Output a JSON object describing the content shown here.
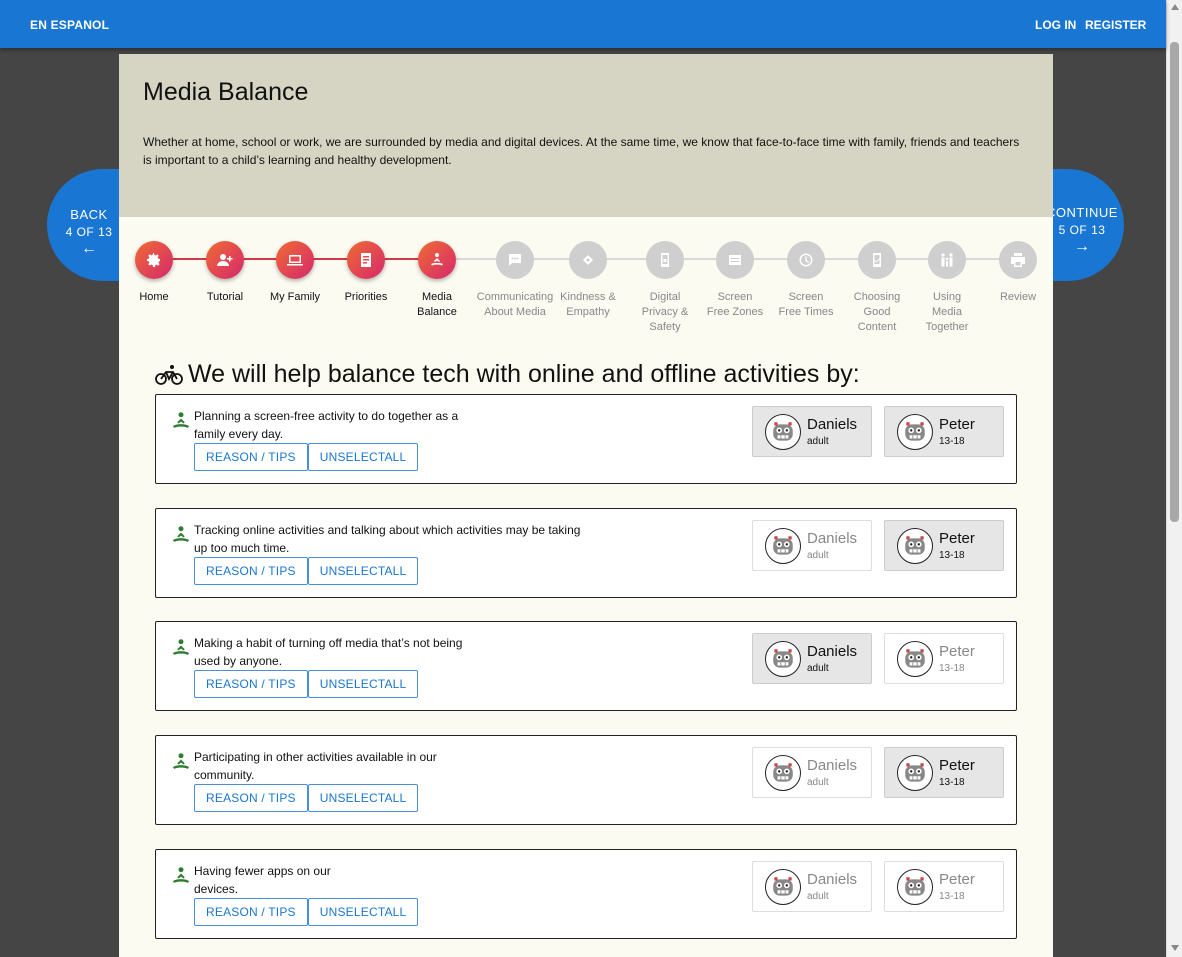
{
  "topbar": {
    "language_link": "EN ESPANOL",
    "login": "LOG IN",
    "register": "REGISTER"
  },
  "nav": {
    "back": {
      "label": "BACK",
      "position": "4 OF 13",
      "arrow": "←"
    },
    "continue": {
      "label": "CONTINUE",
      "position": "5 OF 13",
      "arrow": "→"
    }
  },
  "header": {
    "title": "Media Balance",
    "description": "Whether at home, school or work, we are surrounded by media and digital devices. At the same time, we know that face-to-face time with family, friends and teachers is important to a child’s learning and healthy development."
  },
  "steps": [
    {
      "label": "Home",
      "state": "active",
      "icon": "gear-icon"
    },
    {
      "label": "Tutorial",
      "state": "active",
      "icon": "person-add-icon"
    },
    {
      "label": "My Family",
      "state": "active",
      "icon": "laptop-icon"
    },
    {
      "label": "Priorities",
      "state": "active",
      "icon": "document-icon"
    },
    {
      "label": "Media Balance",
      "state": "active",
      "icon": "meditation-icon"
    },
    {
      "label": "Communicating About Media",
      "state": "inactive",
      "icon": "chat-icon"
    },
    {
      "label": "Kindness & Empathy",
      "state": "inactive",
      "icon": "handshake-icon"
    },
    {
      "label": "Digital Privacy & Safety",
      "state": "inactive",
      "icon": "phone-lock-icon"
    },
    {
      "label": "Screen Free Zones",
      "state": "inactive",
      "icon": "screen-icon"
    },
    {
      "label": "Screen Free Times",
      "state": "inactive",
      "icon": "clock-icon"
    },
    {
      "label": "Choosing Good Content",
      "state": "inactive",
      "icon": "phone-check-icon"
    },
    {
      "label": "Using Media Together",
      "state": "inactive",
      "icon": "family-icon"
    },
    {
      "label": "Review",
      "state": "inactive",
      "icon": "printer-icon"
    }
  ],
  "section": {
    "title": "We will help balance tech with online and offline activities by:",
    "icon": "bicycle-icon"
  },
  "buttons": {
    "reason": "REASON / TIPS",
    "unselect": "UNSELECTALL"
  },
  "activities": [
    {
      "line1": "Planning a screen-free activity to do together as a",
      "line2": "family every day.",
      "members": [
        {
          "name": "Daniels",
          "meta": "adult",
          "selected": true
        },
        {
          "name": "Peter",
          "meta": "13-18",
          "selected": true
        }
      ]
    },
    {
      "line1": "Tracking online activities and talking about which activities may be taking",
      "line2": "up too much time.",
      "members": [
        {
          "name": "Daniels",
          "meta": "adult",
          "selected": false
        },
        {
          "name": "Peter",
          "meta": "13-18",
          "selected": true
        }
      ]
    },
    {
      "line1": "Making a habit of turning off media that’s not being",
      "line2": "used by anyone.",
      "members": [
        {
          "name": "Daniels",
          "meta": "adult",
          "selected": true
        },
        {
          "name": "Peter",
          "meta": "13-18",
          "selected": false
        }
      ]
    },
    {
      "line1": "Participating in other activities available in our",
      "line2": "community.",
      "members": [
        {
          "name": "Daniels",
          "meta": "adult",
          "selected": false
        },
        {
          "name": "Peter",
          "meta": "13-18",
          "selected": true
        }
      ]
    },
    {
      "line1": "Having fewer apps on our",
      "line2": "devices.",
      "members": [
        {
          "name": "Daniels",
          "meta": "adult",
          "selected": false
        },
        {
          "name": "Peter",
          "meta": "13-18",
          "selected": false
        }
      ]
    }
  ]
}
